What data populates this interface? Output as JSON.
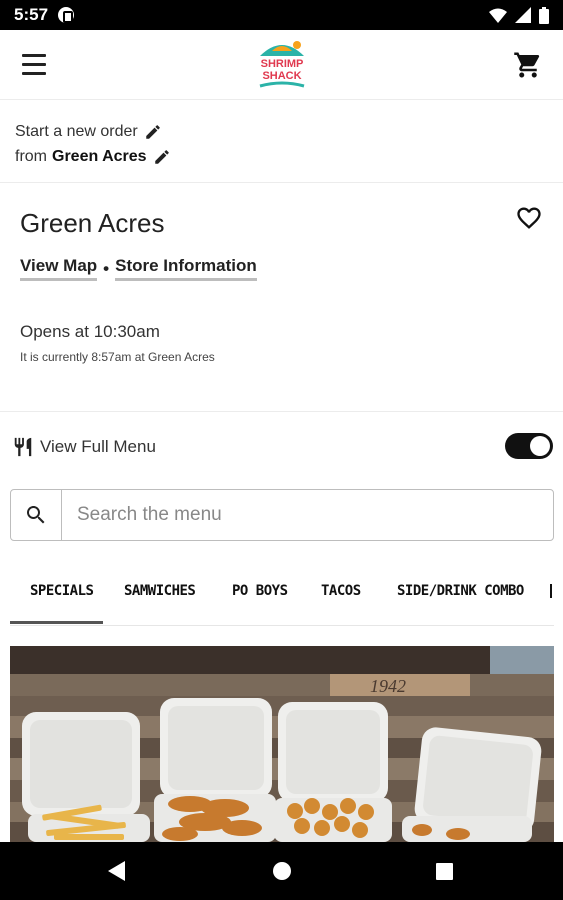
{
  "status_bar": {
    "time": "5:57",
    "icons": [
      "app-notification-icon",
      "wifi-icon",
      "signal-icon",
      "battery-icon"
    ]
  },
  "app_bar": {
    "logo_icon": "shrimp-shack-logo",
    "logo_text_line1": "SHRIMP",
    "logo_text_line2": "SHACK",
    "menu_icon": "hamburger-menu-icon",
    "cart_icon": "cart-icon"
  },
  "order": {
    "line1": "Start a new order",
    "line2_prefix": "from",
    "location": "Green Acres"
  },
  "store": {
    "name": "Green Acres",
    "view_map": "View Map",
    "separator": "•",
    "store_info": "Store Information",
    "opens": "Opens at 10:30am",
    "current_time": "It is currently 8:57am at Green Acres"
  },
  "full_menu": {
    "label": "View Full Menu",
    "toggle_on": true
  },
  "search": {
    "placeholder": "Search the menu"
  },
  "tabs": [
    {
      "label": "SPECIALS",
      "active": true
    },
    {
      "label": "SAMWICHES",
      "active": false
    },
    {
      "label": "PO BOYS",
      "active": false
    },
    {
      "label": "TACOS",
      "active": false
    },
    {
      "label": "SIDE/DRINK COMBO",
      "active": false
    }
  ],
  "hero": {
    "wall_text": "1942"
  },
  "colors": {
    "status_bar_bg": "#000000",
    "toggle_on": "#111111",
    "link_underline": "#bdbdbd",
    "logo_teal": "#2bb3a8",
    "logo_red": "#e0394f",
    "logo_orange": "#f7a21b"
  }
}
